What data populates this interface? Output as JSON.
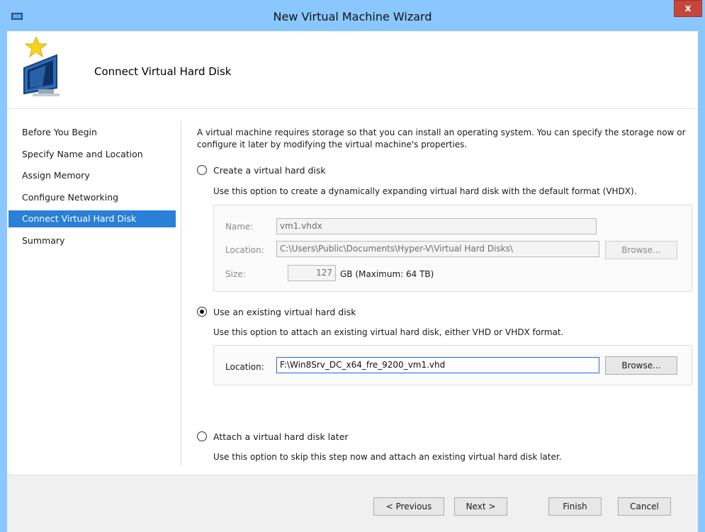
{
  "window": {
    "title": "New Virtual Machine Wizard",
    "close_label": "x"
  },
  "header": {
    "title": "Connect Virtual Hard Disk",
    "icon": "monitor-with-star-icon"
  },
  "sidebar": {
    "items": [
      {
        "label": "Before You Begin"
      },
      {
        "label": "Specify Name and Location"
      },
      {
        "label": "Assign Memory"
      },
      {
        "label": "Configure Networking"
      },
      {
        "label": "Connect Virtual Hard Disk"
      },
      {
        "label": "Summary"
      }
    ],
    "active_index": 4
  },
  "content": {
    "intro": "A virtual machine requires storage so that you can install an operating system. You can specify the storage now or configure it later by modifying the virtual machine's properties.",
    "create_option": {
      "label": "Create a virtual hard disk",
      "checked": false,
      "desc": "Use this option to create a dynamically expanding virtual hard disk with the default format (VHDX).",
      "name_label": "Name:",
      "name_value": "vm1.vhdx",
      "location_label": "Location:",
      "location_value": "C:\\Users\\Public\\Documents\\Hyper-V\\Virtual Hard Disks\\",
      "browse_label": "Browse...",
      "size_label": "Size:",
      "size_value": "127",
      "size_unit": "GB (Maximum: 64 TB)"
    },
    "existing_option": {
      "label": "Use an existing virtual hard disk",
      "checked": true,
      "desc": "Use this option to attach an existing virtual hard disk, either VHD or VHDX format.",
      "location_label": "Location:",
      "location_value": "F:\\Win8Srv_DC_x64_fre_9200_vm1.vhd",
      "browse_label": "Browse..."
    },
    "later_option": {
      "label": "Attach a virtual hard disk later",
      "checked": false,
      "desc": "Use this option to skip this step now and attach an existing virtual hard disk later."
    }
  },
  "footer": {
    "previous_label": "< Previous",
    "next_label": "Next >",
    "finish_label": "Finish",
    "cancel_label": "Cancel"
  },
  "colors": {
    "title_bar": "#8ac7ff",
    "active_nav": "#2a7fd6",
    "close_button": "#c7463b"
  }
}
